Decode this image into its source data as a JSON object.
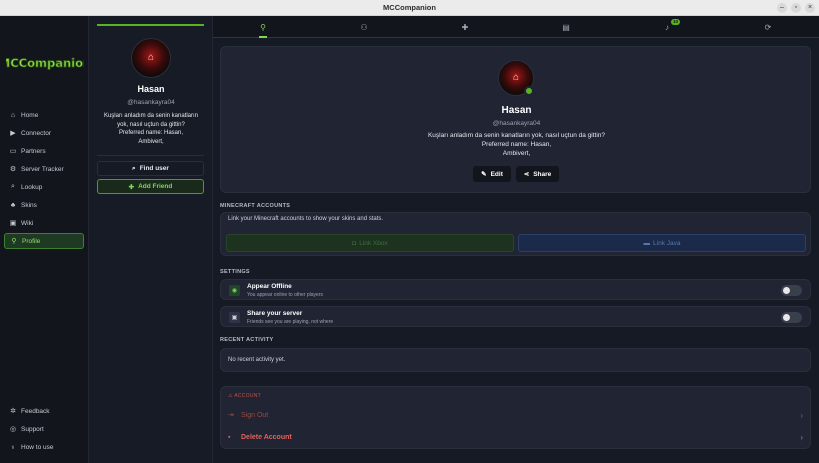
{
  "window": {
    "title": "MCCompanion"
  },
  "nav": {
    "logo_text": "MCCompanion",
    "items": [
      {
        "label": "Home",
        "icon": "home-icon"
      },
      {
        "label": "Connector",
        "icon": "play-icon"
      },
      {
        "label": "Partners",
        "icon": "partners-icon"
      },
      {
        "label": "Server Tracker",
        "icon": "server-icon"
      },
      {
        "label": "Lookup",
        "icon": "search-icon"
      },
      {
        "label": "Skins",
        "icon": "skins-icon"
      },
      {
        "label": "Wiki",
        "icon": "book-icon"
      },
      {
        "label": "Profile",
        "icon": "user-icon"
      }
    ],
    "bottom_items": [
      {
        "label": "Feedback",
        "icon": "gear-icon"
      },
      {
        "label": "Support",
        "icon": "help-icon"
      },
      {
        "label": "How to use",
        "icon": "bulb-icon"
      }
    ],
    "active": "Profile"
  },
  "profile_column": {
    "name": "Hasan",
    "handle": "@hasankayra04",
    "bio": [
      "Kuşları anladım da senin kanatların",
      "yok, nasıl uçtun da gittin?",
      "Preferred name: Hasan,",
      "Ambivert,"
    ],
    "find_user_label": "Find user",
    "add_friend_label": "Add Friend"
  },
  "tabs": {
    "notification_count": "10"
  },
  "profile_card": {
    "name": "Hasan",
    "handle": "@hasankayra04",
    "bio": [
      "Kuşları anladım da senin kanatların yok, nasıl uçtun da gittin?",
      "Preferred name: Hasan,",
      "Ambivert,"
    ],
    "edit_label": "Edit",
    "share_label": "Share"
  },
  "minecraft_accounts": {
    "section_title": "MINECRAFT ACCOUNTS",
    "description": "Link your Minecraft accounts to show your skins and stats.",
    "link_xbox_label": "Link Xbox",
    "link_java_label": "Link Java"
  },
  "settings": {
    "section_title": "SETTINGS",
    "items": [
      {
        "title": "Appear Offline",
        "subtitle": "You appear online to other players",
        "enabled": false
      },
      {
        "title": "Share your server",
        "subtitle": "Friends see you are playing, not where",
        "enabled": false
      }
    ]
  },
  "recent_activity": {
    "section_title": "RECENT ACTIVITY",
    "empty_text": "No recent activity yet."
  },
  "account": {
    "section_title": "ACCOUNT",
    "sign_out_label": "Sign Out",
    "delete_label": "Delete Account"
  },
  "colors": {
    "accent_green": "#57b51f",
    "danger_red": "#e2625a",
    "background": "#161a24"
  }
}
